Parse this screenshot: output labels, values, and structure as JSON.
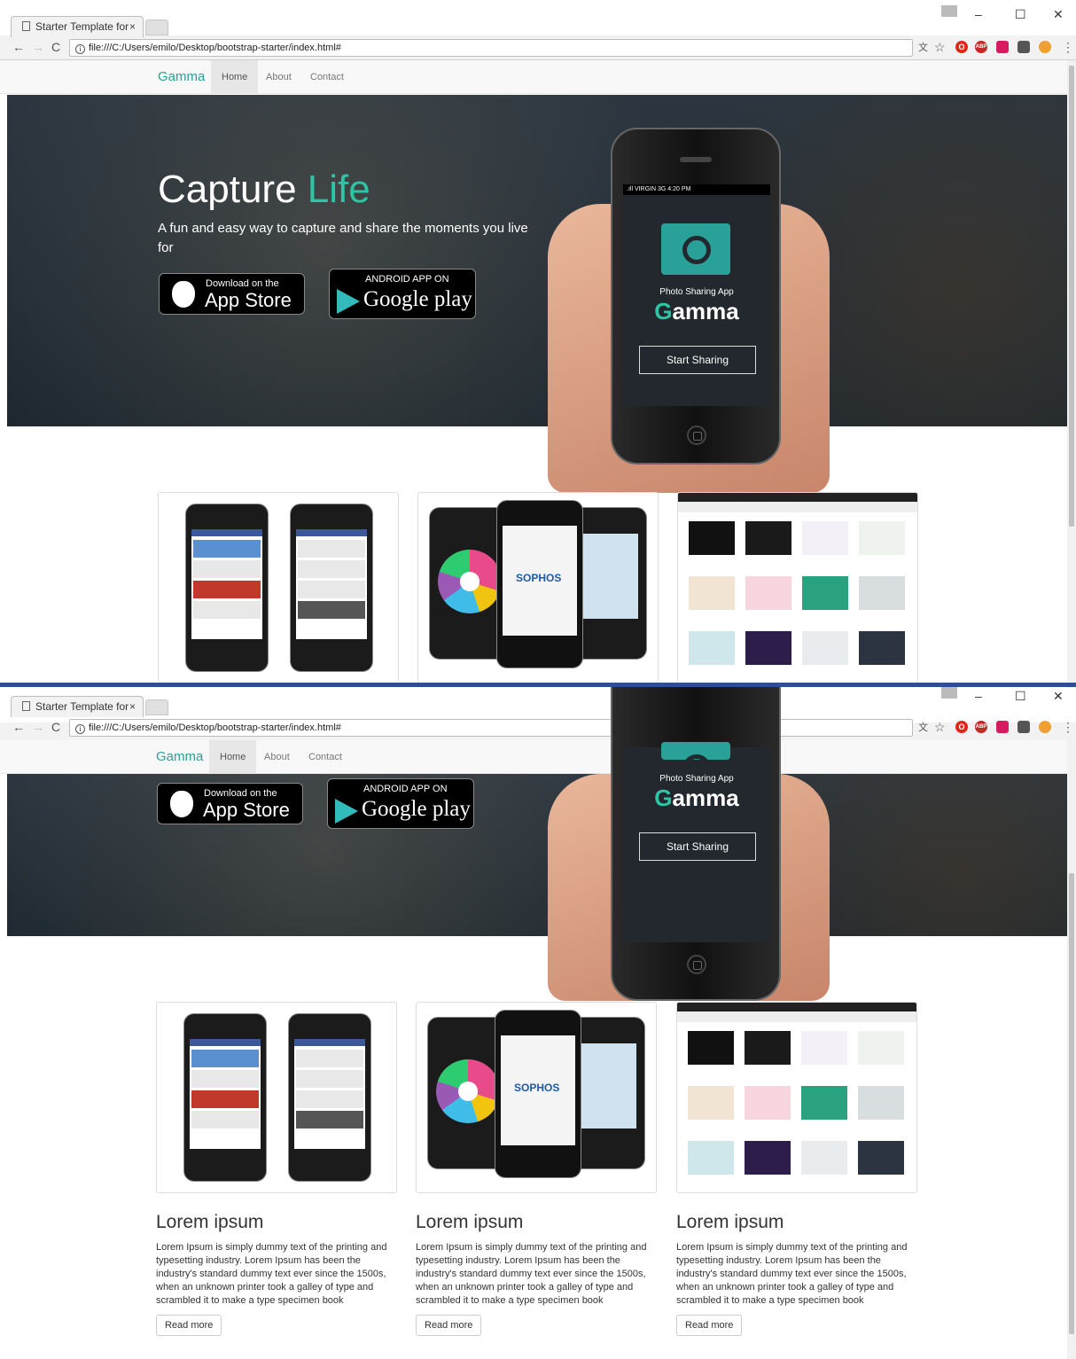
{
  "browser": {
    "tab_title": "Starter Template for",
    "tab_close": "×",
    "url": "file:///C:/Users/emilo/Desktop/bootstrap-starter/index.html#",
    "info_glyph": "i",
    "back_glyph": "←",
    "forward_glyph": "→",
    "reload_glyph": "C",
    "minimize_glyph": "–",
    "maximize_glyph": "☐",
    "close_glyph": "✕",
    "star_glyph": "☆",
    "menu_glyph": "⋮",
    "translate_glyph": "文",
    "ext_abp": "ABP",
    "ext_opera": "O"
  },
  "nav": {
    "brand": "Gamma",
    "items": [
      {
        "label": "Home",
        "active": true
      },
      {
        "label": "About",
        "active": false
      },
      {
        "label": "Contact",
        "active": false
      }
    ]
  },
  "hero": {
    "title_part1": "Capture ",
    "title_part2": "Life",
    "subtitle": "A fun and easy way to capture and share the moments you live for",
    "appstore_small": "Download on the",
    "appstore_big": "App Store",
    "googleplay_small": "ANDROID APP ON",
    "googleplay_big": "Google play"
  },
  "phone": {
    "status": ".ıll VIRGIN  3G        4:20 PM",
    "caption": "Photo Sharing App",
    "app_name_g": "G",
    "app_name_rest": "amma",
    "button": "Start Sharing"
  },
  "thumbs": {
    "sophos": "SOPHOS"
  },
  "columns": [
    {
      "title": "Lorem ipsum",
      "text": "Lorem Ipsum is simply dummy text of the printing and typesetting industry. Lorem Ipsum has been the industry's standard dummy text ever since the 1500s, when an unknown printer took a galley of type and scrambled it to make a type specimen book",
      "button": "Read more"
    },
    {
      "title": "Lorem ipsum",
      "text": "Lorem Ipsum is simply dummy text of the printing and typesetting industry. Lorem Ipsum has been the industry's standard dummy text ever since the 1500s, when an unknown printer took a galley of type and scrambled it to make a type specimen book",
      "button": "Read more"
    },
    {
      "title": "Lorem ipsum",
      "text": "Lorem Ipsum is simply dummy text of the printing and typesetting industry. Lorem Ipsum has been the industry's standard dummy text ever since the 1500s, when an unknown printer took a galley of type and scrambled it to make a type specimen book",
      "button": "Read more"
    }
  ],
  "colors": {
    "brand": "#2aa198",
    "accent": "#2ec4a6",
    "hero_bg": "#1d2830"
  }
}
